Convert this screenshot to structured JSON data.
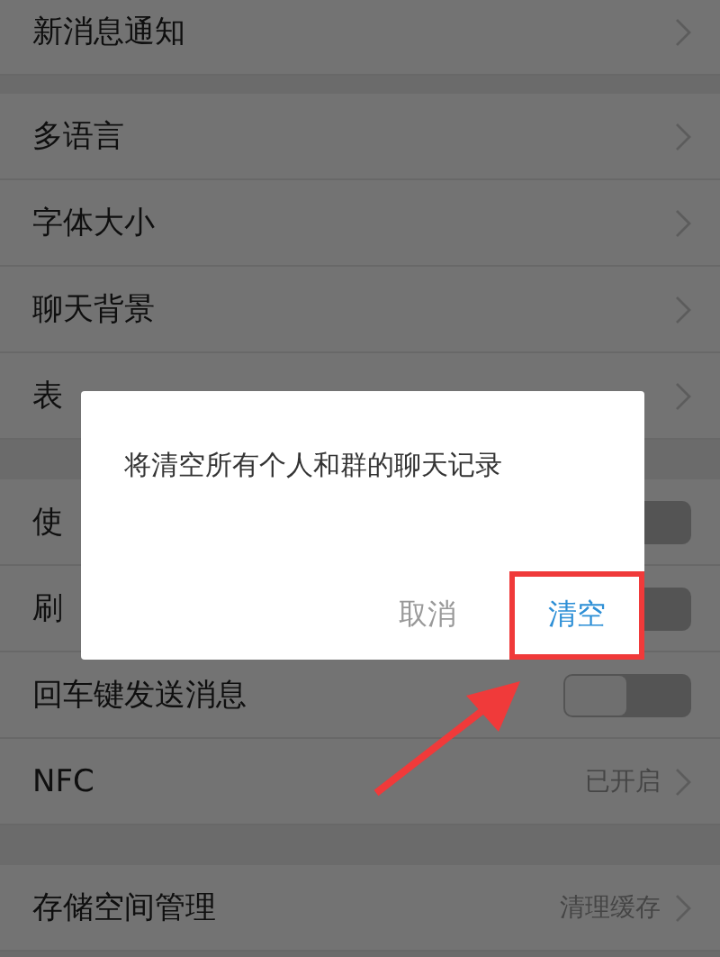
{
  "sections": [
    {
      "rows": [
        {
          "kind": "link",
          "label": "新消息通知"
        }
      ]
    },
    {
      "rows": [
        {
          "kind": "link",
          "label": "多语言"
        },
        {
          "kind": "link",
          "label": "字体大小"
        },
        {
          "kind": "link",
          "label": "聊天背景"
        },
        {
          "kind": "link",
          "label": "表"
        }
      ]
    },
    {
      "rows": [
        {
          "kind": "toggle",
          "label": "使",
          "on": false
        },
        {
          "kind": "toggle",
          "label": "刷",
          "on": false
        },
        {
          "kind": "toggle",
          "label": "回车键发送消息",
          "on": false
        },
        {
          "kind": "link",
          "label": "NFC",
          "value": "已开启"
        }
      ]
    },
    {
      "rows": [
        {
          "kind": "link",
          "label": "存储空间管理",
          "value": "清理缓存"
        }
      ]
    }
  ],
  "dialog": {
    "message": "将清空所有个人和群的聊天记录",
    "buttons": [
      {
        "label": "取消",
        "primary": false,
        "highlighted": false
      },
      {
        "label": "清空",
        "primary": true,
        "highlighted": true
      }
    ]
  }
}
